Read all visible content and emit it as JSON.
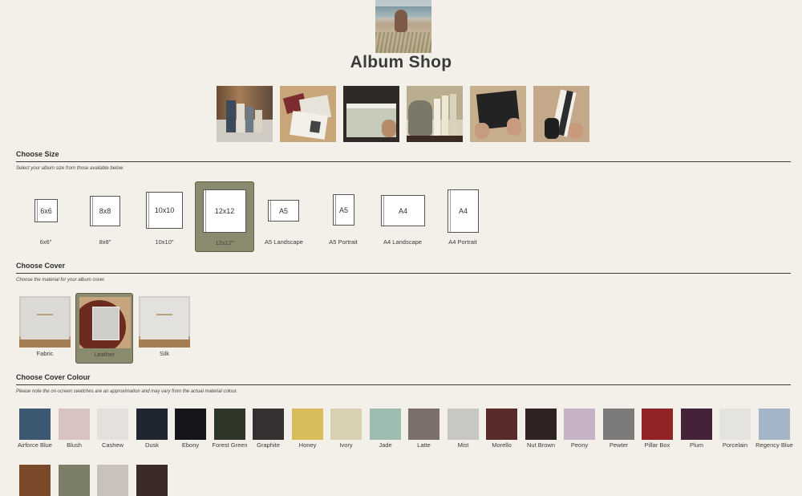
{
  "page": {
    "title": "Album Shop"
  },
  "size_section": {
    "title": "Choose Size",
    "note": "Select your album size from those available below.",
    "options": [
      {
        "label": "6x6",
        "caption": "6x6\"",
        "selected": false
      },
      {
        "label": "8x8",
        "caption": "8x8\"",
        "selected": false
      },
      {
        "label": "10x10",
        "caption": "10x10\"",
        "selected": false
      },
      {
        "label": "12x12",
        "caption": "12x12\"",
        "selected": true
      },
      {
        "label": "A5",
        "caption": "A5 Landscape",
        "selected": false
      },
      {
        "label": "A5",
        "caption": "A5 Portrait",
        "selected": false
      },
      {
        "label": "A4",
        "caption": "A4 Landscape",
        "selected": false
      },
      {
        "label": "A4",
        "caption": "A4 Portrait",
        "selected": false
      }
    ]
  },
  "cover_section": {
    "title": "Choose Cover",
    "note": "Choose the material for your album cover.",
    "options": [
      {
        "caption": "Fabric",
        "selected": false
      },
      {
        "caption": "Leather",
        "selected": true
      },
      {
        "caption": "Silk",
        "selected": false
      }
    ]
  },
  "colour_section": {
    "title": "Choose Cover Colour",
    "note": "Please note the on-screen swatches are an approximation and may vary from the actual material colour.",
    "swatches": [
      {
        "name": "Airforce Blue",
        "color": "#3d5873"
      },
      {
        "name": "Blush",
        "color": "#d8c3c3"
      },
      {
        "name": "Cashew",
        "color": "#e4e1dc"
      },
      {
        "name": "Dusk",
        "color": "#1f2630"
      },
      {
        "name": "Ebony",
        "color": "#15161a"
      },
      {
        "name": "Forest Green",
        "color": "#2e3628"
      },
      {
        "name": "Graphite",
        "color": "#353131"
      },
      {
        "name": "Honey",
        "color": "#d9bc5c"
      },
      {
        "name": "Ivory",
        "color": "#d9cfb3"
      },
      {
        "name": "Jade",
        "color": "#9fbcb0"
      },
      {
        "name": "Latte",
        "color": "#7b6f69"
      },
      {
        "name": "Mist",
        "color": "#c9c7c4"
      },
      {
        "name": "Morello",
        "color": "#5a2a29"
      },
      {
        "name": "Nut Brown",
        "color": "#2f2221"
      },
      {
        "name": "Peony",
        "color": "#c7b1c7"
      },
      {
        "name": "Pewter",
        "color": "#7d7b7a"
      },
      {
        "name": "Pillar Box",
        "color": "#912327"
      },
      {
        "name": "Plum",
        "color": "#44233a"
      },
      {
        "name": "Porcelain",
        "color": "#e4e3df"
      },
      {
        "name": "Regency Blue",
        "color": "#a3b5c6"
      }
    ],
    "swatches_row2": [
      {
        "color": "#7a4a2a"
      },
      {
        "color": "#7c7e68"
      },
      {
        "color": "#c8c2bb"
      },
      {
        "color": "#3a2b27"
      }
    ]
  }
}
